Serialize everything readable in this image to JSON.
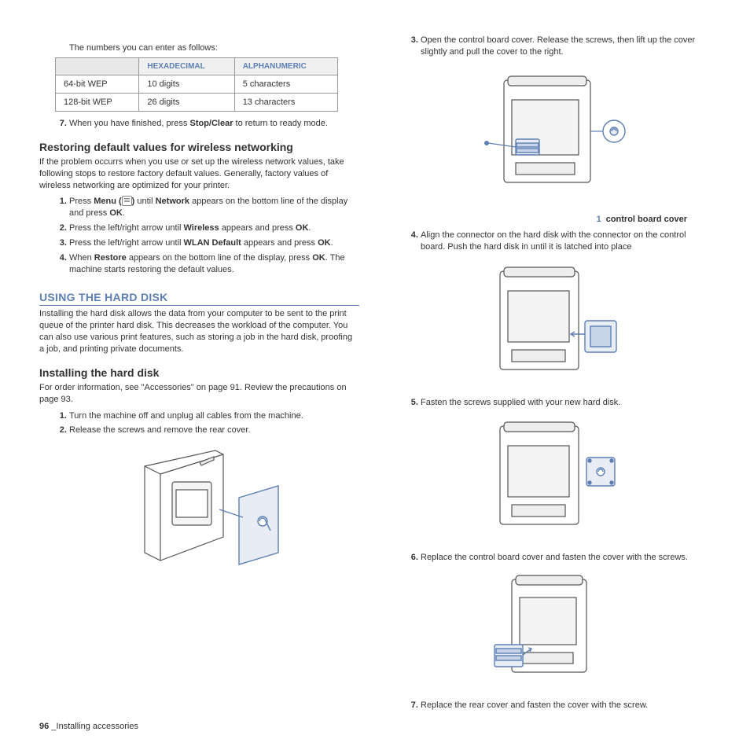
{
  "left": {
    "intro": "The numbers you can enter as follows:",
    "table": {
      "headers": [
        "",
        "Hexadecimal",
        "Alphanumeric"
      ],
      "rows": [
        [
          "64-bit WEP",
          "10 digits",
          "5 characters"
        ],
        [
          "128-bit WEP",
          "26 digits",
          "13 characters"
        ]
      ]
    },
    "step7_a": "When you have finished, press ",
    "step7_b": "Stop/Clear",
    "step7_c": " to return to ready mode.",
    "restore_heading": "Restoring default values for wireless networking",
    "restore_body": "If the problem occurrs when you use or set up the wireless network values, take following stops to restore factory default values. Generally, factory values of wireless networking are optimized for your printer.",
    "restore_steps": {
      "s1a": "Press ",
      "s1b": "Menu (",
      "s1c": ")",
      "s1d": " until ",
      "s1e": "Network",
      "s1f": " appears on the bottom line of the display and press ",
      "s1g": "OK",
      "s1h": ".",
      "s2a": "Press the left/right arrow until ",
      "s2b": "Wireless",
      "s2c": " appears and press ",
      "s2d": "OK",
      "s2e": ".",
      "s3a": "Press the left/right arrow until ",
      "s3b": "WLAN Default",
      "s3c": " appears and press ",
      "s3d": "OK",
      "s3e": ".",
      "s4a": "When  ",
      "s4b": "Restore",
      "s4c": " appears on the bottom line of the display, press ",
      "s4d": "OK",
      "s4e": ". The machine starts restoring the default values."
    },
    "h2": "Using the hard disk",
    "h2_body": "Installing the hard disk allows the data from your computer to be sent to the print queue of the printer hard disk. This decreases the workload of the computer. You can also use various print features, such as storing a job in the hard disk, proofing a job, and printing private documents.",
    "install_heading": "Installing the hard disk",
    "install_body": "For order information, see \"Accessories\" on page 91. Review the precautions on page 93.",
    "install_steps": {
      "s1": "Turn the machine off and unplug all cables from the machine.",
      "s2": "Release the screws and remove the rear cover."
    }
  },
  "right": {
    "s3": "Open the control board cover. Release the screws, then lift up the cover slightly and pull the cover to the right.",
    "callout_num": "1",
    "callout_text": "control board cover",
    "s4": "Align the connector on the hard disk with the connector on the control board. Push the hard disk in until it is latched into place",
    "s5": "Fasten the screws supplied with your new hard disk.",
    "s6": "Replace the control board cover and fasten the cover with the screws.",
    "s7": "Replace the rear cover and fasten the cover with the screw."
  },
  "footer": {
    "page": "96",
    "sep": " _",
    "title": "Installing accessories"
  }
}
